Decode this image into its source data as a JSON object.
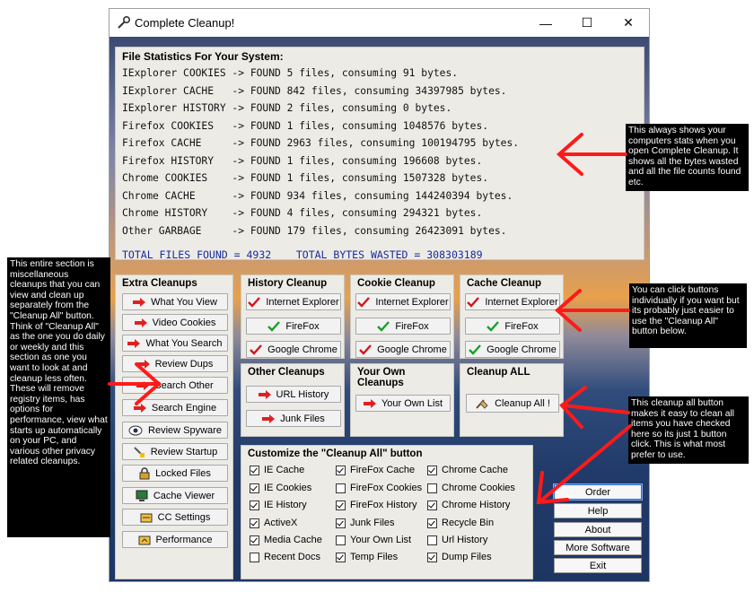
{
  "window": {
    "title": "Complete Cleanup!",
    "minimize": "—",
    "maximize": "☐",
    "close": "✕"
  },
  "stats": {
    "header": "File Statistics For Your System:",
    "lines": [
      "IExplorer COOKIES -> FOUND 5 files, consuming 91 bytes.",
      "IExplorer CACHE   -> FOUND 842 files, consuming 34397985 bytes.",
      "IExplorer HISTORY -> FOUND 2 files, consuming 0 bytes.",
      "Firefox COOKIES   -> FOUND 1 files, consuming 1048576 bytes.",
      "Firefox CACHE     -> FOUND 2963 files, consuming 100194795 bytes.",
      "Firefox HISTORY   -> FOUND 1 files, consuming 196608 bytes.",
      "Chrome COOKIES    -> FOUND 1 files, consuming 1507328 bytes.",
      "Chrome CACHE      -> FOUND 934 files, consuming 144240394 bytes.",
      "Chrome HISTORY    -> FOUND 4 files, consuming 294321 bytes.",
      "Other GARBAGE     -> FOUND 179 files, consuming 26423091 bytes."
    ],
    "total": "TOTAL FILES FOUND = 4932    TOTAL BYTES WASTED = 308303189"
  },
  "extra": {
    "title": "Extra Cleanups",
    "buttons": [
      "What You View",
      "Video Cookies",
      "What You Search",
      "Review Dups",
      "Search Other",
      "Search Engine",
      "Review Spyware",
      "Review Startup",
      "Locked Files",
      "Cache Viewer",
      "CC Settings",
      "Performance"
    ]
  },
  "history": {
    "title": "History Cleanup",
    "buttons": [
      "Internet Explorer",
      "FireFox",
      "Google Chrome"
    ]
  },
  "cookie": {
    "title": "Cookie Cleanup",
    "buttons": [
      "Internet Explorer",
      "FireFox",
      "Google Chrome"
    ]
  },
  "cache": {
    "title": "Cache Cleanup",
    "buttons": [
      "Internet Explorer",
      "FireFox",
      "Google Chrome"
    ]
  },
  "other": {
    "title": "Other Cleanups",
    "buttons": [
      "URL History",
      "Junk Files"
    ]
  },
  "own": {
    "title": "Your Own Cleanups",
    "button": "Your Own List"
  },
  "all": {
    "title": "Cleanup ALL",
    "button": "Cleanup All !"
  },
  "customize": {
    "title": "Customize the \"Cleanup All\" button",
    "options": [
      {
        "label": "IE Cache",
        "checked": true
      },
      {
        "label": "IE Cookies",
        "checked": true
      },
      {
        "label": "IE History",
        "checked": true
      },
      {
        "label": "ActiveX",
        "checked": true
      },
      {
        "label": "Media Cache",
        "checked": true
      },
      {
        "label": "Recent Docs",
        "checked": false
      },
      {
        "label": "FireFox Cache",
        "checked": true
      },
      {
        "label": "FireFox Cookies",
        "checked": false
      },
      {
        "label": "FireFox History",
        "checked": true
      },
      {
        "label": "Junk Files",
        "checked": true
      },
      {
        "label": "Your Own List",
        "checked": false
      },
      {
        "label": "Temp Files",
        "checked": true
      },
      {
        "label": "Chrome Cache",
        "checked": true
      },
      {
        "label": "Chrome Cookies",
        "checked": false
      },
      {
        "label": "Chrome History",
        "checked": true
      },
      {
        "label": "Recycle Bin",
        "checked": true
      },
      {
        "label": "Url History",
        "checked": false
      },
      {
        "label": "Dump Files",
        "checked": true
      }
    ]
  },
  "right_buttons": [
    "Order",
    "Help",
    "About",
    "More Software",
    "Exit"
  ],
  "notes": {
    "stats_note": "This always shows your computers stats when you open Complete Cleanup. It shows all the bytes wasted and all the file counts found etc.",
    "extra_note": "This entire section is miscellaneous cleanups that you can view and clean up separately from the \"Cleanup All\" button. Think of \"Cleanup All\" as the one you do daily or weekly and this section as one you want to look at and cleanup less often. These will remove registry items, has options for performance, view what starts up automatically on your PC, and various other privacy related cleanups.",
    "buttons_note": "You can click buttons individually if you want but its probably just easier to use the \"Cleanup All\" button below.",
    "all_note": "This cleanup all button makes it easy to clean all items you have checked here so its just 1 button click. This is what most prefer to use."
  },
  "colors": {
    "annotation_arrow": "#ff1a1a",
    "total_text": "#1a2a9a",
    "panel_bg": "#ecebe6"
  }
}
